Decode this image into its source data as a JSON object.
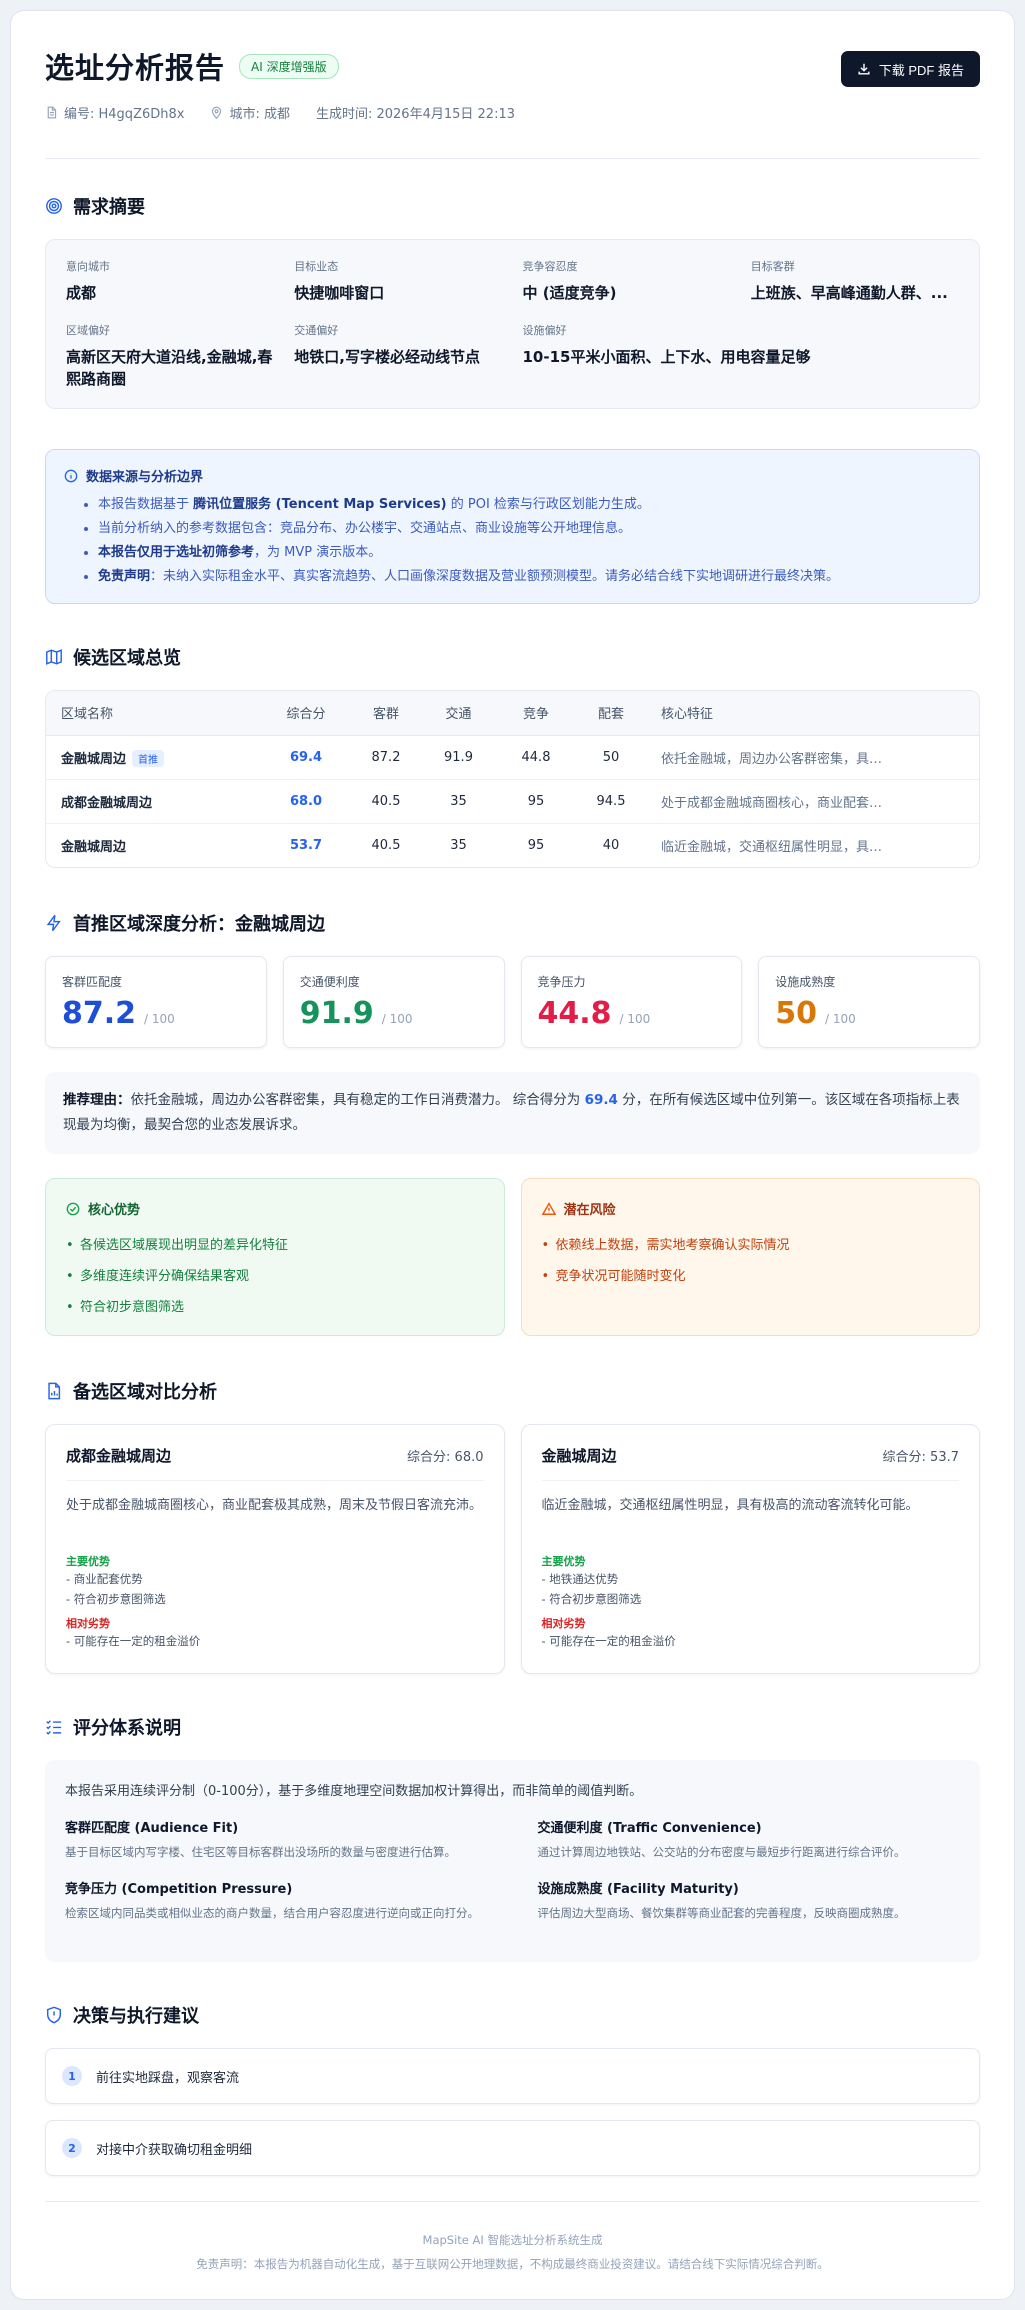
{
  "header": {
    "title": "选址分析报告",
    "badge": "AI 深度增强版",
    "report_id": "编号: H4gqZ6Dh8x",
    "city": "城市: 成都",
    "generated_at": "生成时间: 2026年4月15日 22:13",
    "download_label": "下载 PDF 报告"
  },
  "summary": {
    "title": "需求摘要",
    "items": [
      {
        "label": "意向城市",
        "value": "成都"
      },
      {
        "label": "目标业态",
        "value": "快捷咖啡窗口"
      },
      {
        "label": "竞争容忍度",
        "value": "中 (适度竞争)"
      },
      {
        "label": "目标客群",
        "value": "上班族、早高峰通勤人群、..."
      },
      {
        "label": "区域偏好",
        "value": "高新区天府大道沿线,金融城,春熙路商圈"
      },
      {
        "label": "交通偏好",
        "value": "地铁口,写字楼必经动线节点"
      },
      {
        "label": "设施偏好",
        "value": "10-15平米小面积、上下水、用电容量足够"
      }
    ]
  },
  "notice": {
    "title": "数据来源与分析边界",
    "line1_pre": "本报告数据基于 ",
    "line1_bold": "腾讯位置服务 (Tencent Map Services)",
    "line1_post": " 的 POI 检索与行政区划能力生成。",
    "line2": "当前分析纳入的参考数据包含：竞品分布、办公楼宇、交通站点、商业设施等公开地理信息。",
    "line3_bold": "本报告仅用于选址初筛参考",
    "line3_post": "，为 MVP 演示版本。",
    "line4_bold": "免责声明",
    "line4_post": "：未纳入实际租金水平、真实客流趋势、人口画像深度数据及营业额预测模型。请务必结合线下实地调研进行最终决策。"
  },
  "overview": {
    "title": "候选区域总览",
    "columns": [
      "区域名称",
      "综合分",
      "客群",
      "交通",
      "竞争",
      "配套",
      "核心特征"
    ],
    "first_tag": "首推",
    "rows": [
      {
        "name": "金融城周边",
        "score": "69.4",
        "audience": "87.2",
        "traffic": "91.9",
        "competition": "44.8",
        "facility": "50",
        "feature": "依托金融城，周边办公客群密集，具有稳定的工作日消费潜力。"
      },
      {
        "name": "成都金融城周边",
        "score": "68.0",
        "audience": "40.5",
        "traffic": "35",
        "competition": "95",
        "facility": "94.5",
        "feature": "处于成都金融城商圈核心，商业配套极其成熟，周末及节假日客流充沛。"
      },
      {
        "name": "金融城周边",
        "score": "53.7",
        "audience": "40.5",
        "traffic": "35",
        "competition": "95",
        "facility": "40",
        "feature": "临近金融城，交通枢纽属性明显，具有极高的流动客流转化可能。"
      }
    ]
  },
  "deep": {
    "title": "首推区域深度分析：金融城周边",
    "metrics": [
      {
        "label": "客群匹配度",
        "value": "87.2",
        "max": "/ 100",
        "color": "#1d4ed8"
      },
      {
        "label": "交通便利度",
        "value": "91.9",
        "max": "/ 100",
        "color": "#15935a"
      },
      {
        "label": "竞争压力",
        "value": "44.8",
        "max": "/ 100",
        "color": "#e11d48"
      },
      {
        "label": "设施成熟度",
        "value": "50",
        "max": "/ 100",
        "color": "#d97706"
      }
    ],
    "reason_label": "推荐理由：",
    "reason_pre": "依托金融城，周边办公客群密集，具有稳定的工作日消费潜力。 综合得分为 ",
    "reason_score": "69.4",
    "reason_post": " 分，在所有候选区域中位列第一。该区域在各项指标上表现最为均衡，最契合您的业态发展诉求。",
    "pros_title": "核心优势",
    "pros": [
      "各候选区域展现出明显的差异化特征",
      "多维度连续评分确保结果客观",
      "符合初步意图筛选"
    ],
    "cons_title": "潜在风险",
    "cons": [
      "依赖线上数据，需实地考察确认实际情况",
      "竞争状况可能随时变化"
    ]
  },
  "compare": {
    "title": "备选区域对比分析",
    "cards": [
      {
        "name": "成都金融城周边",
        "score": "综合分: 68.0",
        "desc": "处于成都金融城商圈核心，商业配套极其成熟，周末及节假日客流充沛。",
        "adv_title": "主要优势",
        "adv": [
          "- 商业配套优势",
          "- 符合初步意图筛选"
        ],
        "dis_title": "相对劣势",
        "dis": [
          "- 可能存在一定的租金溢价"
        ]
      },
      {
        "name": "金融城周边",
        "score": "综合分: 53.7",
        "desc": "临近金融城，交通枢纽属性明显，具有极高的流动客流转化可能。",
        "adv_title": "主要优势",
        "adv": [
          "- 地铁通达优势",
          "- 符合初步意图筛选"
        ],
        "dis_title": "相对劣势",
        "dis": [
          "- 可能存在一定的租金溢价"
        ]
      }
    ]
  },
  "scoring": {
    "title": "评分体系说明",
    "intro": "本报告采用连续评分制（0-100分），基于多维度地理空间数据加权计算得出，而非简单的阈值判断。",
    "items": [
      {
        "title": "客群匹配度 (Audience Fit)",
        "desc": "基于目标区域内写字楼、住宅区等目标客群出没场所的数量与密度进行估算。"
      },
      {
        "title": "交通便利度 (Traffic Convenience)",
        "desc": "通过计算周边地铁站、公交站的分布密度与最短步行距离进行综合评价。"
      },
      {
        "title": "竞争压力 (Competition Pressure)",
        "desc": "检索区域内同品类或相似业态的商户数量，结合用户容忍度进行逆向或正向打分。"
      },
      {
        "title": "设施成熟度 (Facility Maturity)",
        "desc": "评估周边大型商场、餐饮集群等商业配套的完善程度，反映商圈成熟度。"
      }
    ]
  },
  "decision": {
    "title": "决策与执行建议",
    "steps": [
      {
        "num": "1",
        "text": "前往实地踩盘，观察客流"
      },
      {
        "num": "2",
        "text": "对接中介获取确切租金明细"
      }
    ]
  },
  "footer": {
    "line1": "MapSite AI 智能选址分析系统生成",
    "line2": "免责声明：本报告为机器自动化生成，基于互联网公开地理数据，不构成最终商业投资建议。请结合线下实际情况综合判断。"
  },
  "colors": {
    "accent": "#2563eb",
    "dark": "#0f172a"
  }
}
